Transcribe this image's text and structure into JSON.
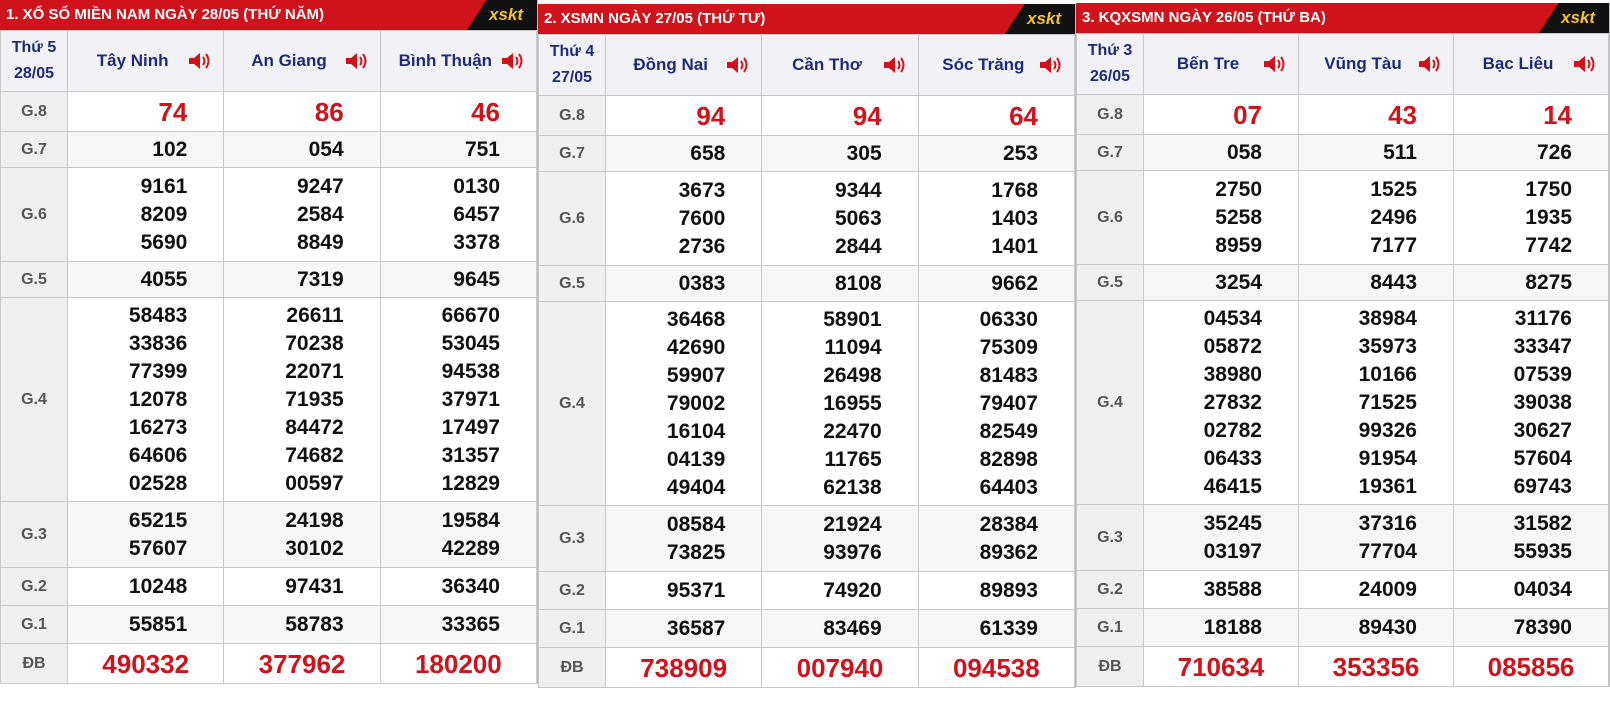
{
  "colors": {
    "header_bg": "#d0121b",
    "accent_red": "#d0121b",
    "header_text": "#1c2a7a"
  },
  "logo_text": "xskt",
  "panels": [
    {
      "title": "1. XỔ SỐ MIỀN NAM NGÀY 28/05 (THỨ NĂM)",
      "day": "Thứ 5",
      "date": "28/05",
      "provinces": [
        "Tây Ninh",
        "An Giang",
        "Bình Thuận"
      ],
      "prizes": [
        {
          "label": "G.8",
          "values": [
            [
              "74"
            ],
            [
              "86"
            ],
            [
              "46"
            ]
          ]
        },
        {
          "label": "G.7",
          "values": [
            [
              "102"
            ],
            [
              "054"
            ],
            [
              "751"
            ]
          ]
        },
        {
          "label": "G.6",
          "values": [
            [
              "9161",
              "8209",
              "5690"
            ],
            [
              "9247",
              "2584",
              "8849"
            ],
            [
              "0130",
              "6457",
              "3378"
            ]
          ]
        },
        {
          "label": "G.5",
          "values": [
            [
              "4055"
            ],
            [
              "7319"
            ],
            [
              "9645"
            ]
          ]
        },
        {
          "label": "G.4",
          "values": [
            [
              "58483",
              "33836",
              "77399",
              "12078",
              "16273",
              "64606",
              "02528"
            ],
            [
              "26611",
              "70238",
              "22071",
              "71935",
              "84472",
              "74682",
              "00597"
            ],
            [
              "66670",
              "53045",
              "94538",
              "37971",
              "17497",
              "31357",
              "12829"
            ]
          ]
        },
        {
          "label": "G.3",
          "values": [
            [
              "65215",
              "57607"
            ],
            [
              "24198",
              "30102"
            ],
            [
              "19584",
              "42289"
            ]
          ]
        },
        {
          "label": "G.2",
          "values": [
            [
              "10248"
            ],
            [
              "97431"
            ],
            [
              "36340"
            ]
          ]
        },
        {
          "label": "G.1",
          "values": [
            [
              "55851"
            ],
            [
              "58783"
            ],
            [
              "33365"
            ]
          ]
        },
        {
          "label": "ĐB",
          "values": [
            [
              "490332"
            ],
            [
              "377962"
            ],
            [
              "180200"
            ]
          ]
        }
      ]
    },
    {
      "title": "2. XSMN NGÀY 27/05 (THỨ TƯ)",
      "day": "Thứ 4",
      "date": "27/05",
      "provinces": [
        "Đồng Nai",
        "Cần Thơ",
        "Sóc Trăng"
      ],
      "prizes": [
        {
          "label": "G.8",
          "values": [
            [
              "94"
            ],
            [
              "94"
            ],
            [
              "64"
            ]
          ]
        },
        {
          "label": "G.7",
          "values": [
            [
              "658"
            ],
            [
              "305"
            ],
            [
              "253"
            ]
          ]
        },
        {
          "label": "G.6",
          "values": [
            [
              "3673",
              "7600",
              "2736"
            ],
            [
              "9344",
              "5063",
              "2844"
            ],
            [
              "1768",
              "1403",
              "1401"
            ]
          ]
        },
        {
          "label": "G.5",
          "values": [
            [
              "0383"
            ],
            [
              "8108"
            ],
            [
              "9662"
            ]
          ]
        },
        {
          "label": "G.4",
          "values": [
            [
              "36468",
              "42690",
              "59907",
              "79002",
              "16104",
              "04139",
              "49404"
            ],
            [
              "58901",
              "11094",
              "26498",
              "16955",
              "22470",
              "11765",
              "62138"
            ],
            [
              "06330",
              "75309",
              "81483",
              "79407",
              "82549",
              "82898",
              "64403"
            ]
          ]
        },
        {
          "label": "G.3",
          "values": [
            [
              "08584",
              "73825"
            ],
            [
              "21924",
              "93976"
            ],
            [
              "28384",
              "89362"
            ]
          ]
        },
        {
          "label": "G.2",
          "values": [
            [
              "95371"
            ],
            [
              "74920"
            ],
            [
              "89893"
            ]
          ]
        },
        {
          "label": "G.1",
          "values": [
            [
              "36587"
            ],
            [
              "83469"
            ],
            [
              "61339"
            ]
          ]
        },
        {
          "label": "ĐB",
          "values": [
            [
              "738909"
            ],
            [
              "007940"
            ],
            [
              "094538"
            ]
          ]
        }
      ]
    },
    {
      "title": "3. KQXSMN NGÀY 26/05 (THỨ BA)",
      "day": "Thứ 3",
      "date": "26/05",
      "provinces": [
        "Bến Tre",
        "Vũng Tàu",
        "Bạc Liêu"
      ],
      "prizes": [
        {
          "label": "G.8",
          "values": [
            [
              "07"
            ],
            [
              "43"
            ],
            [
              "14"
            ]
          ]
        },
        {
          "label": "G.7",
          "values": [
            [
              "058"
            ],
            [
              "511"
            ],
            [
              "726"
            ]
          ]
        },
        {
          "label": "G.6",
          "values": [
            [
              "2750",
              "5258",
              "8959"
            ],
            [
              "1525",
              "2496",
              "7177"
            ],
            [
              "1750",
              "1935",
              "7742"
            ]
          ]
        },
        {
          "label": "G.5",
          "values": [
            [
              "3254"
            ],
            [
              "8443"
            ],
            [
              "8275"
            ]
          ]
        },
        {
          "label": "G.4",
          "values": [
            [
              "04534",
              "05872",
              "38980",
              "27832",
              "02782",
              "06433",
              "46415"
            ],
            [
              "38984",
              "35973",
              "10166",
              "71525",
              "99326",
              "91954",
              "19361"
            ],
            [
              "31176",
              "33347",
              "07539",
              "39038",
              "30627",
              "57604",
              "69743"
            ]
          ]
        },
        {
          "label": "G.3",
          "values": [
            [
              "35245",
              "03197"
            ],
            [
              "37316",
              "77704"
            ],
            [
              "31582",
              "55935"
            ]
          ]
        },
        {
          "label": "G.2",
          "values": [
            [
              "38588"
            ],
            [
              "24009"
            ],
            [
              "04034"
            ]
          ]
        },
        {
          "label": "G.1",
          "values": [
            [
              "18188"
            ],
            [
              "89430"
            ],
            [
              "78390"
            ]
          ]
        },
        {
          "label": "ĐB",
          "values": [
            [
              "710634"
            ],
            [
              "353356"
            ],
            [
              "085856"
            ]
          ]
        }
      ]
    }
  ]
}
